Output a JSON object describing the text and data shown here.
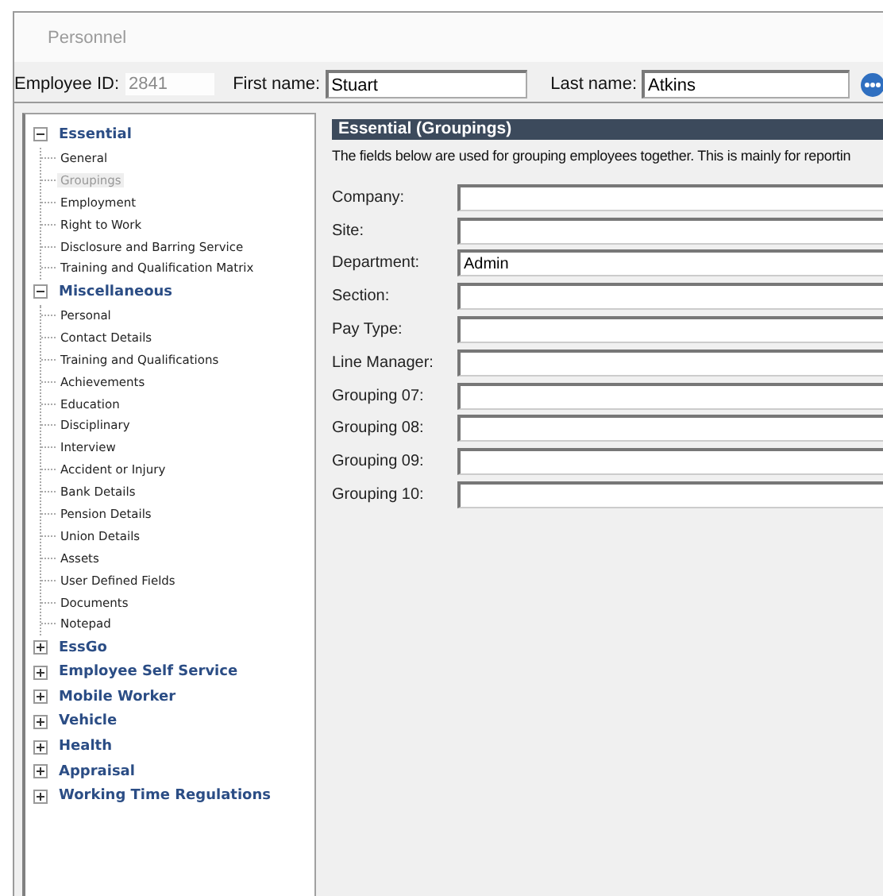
{
  "window": {
    "title": "Personnel"
  },
  "header": {
    "employee_id": {
      "label": "Employee ID:",
      "value": "2841"
    },
    "first_name": {
      "label": "First name:",
      "value": "Stuart"
    },
    "last_name": {
      "label": "Last name:",
      "value": "Atkins"
    }
  },
  "sidebar": {
    "groups": [
      {
        "label": "Essential",
        "expanded": true,
        "children": [
          {
            "label": "General",
            "selected": false
          },
          {
            "label": "Groupings",
            "selected": true
          },
          {
            "label": "Employment",
            "selected": false
          },
          {
            "label": "Right to Work",
            "selected": false
          },
          {
            "label": "Disclosure and Barring Service",
            "selected": false
          },
          {
            "label": "Training and Qualification Matrix",
            "selected": false
          }
        ]
      },
      {
        "label": "Miscellaneous",
        "expanded": true,
        "children": [
          {
            "label": "Personal",
            "selected": false
          },
          {
            "label": "Contact Details",
            "selected": false
          },
          {
            "label": "Training and Qualifications",
            "selected": false
          },
          {
            "label": "Achievements",
            "selected": false
          },
          {
            "label": "Education",
            "selected": false
          },
          {
            "label": "Disciplinary",
            "selected": false
          },
          {
            "label": "Interview",
            "selected": false
          },
          {
            "label": "Accident or Injury",
            "selected": false
          },
          {
            "label": "Bank Details",
            "selected": false
          },
          {
            "label": "Pension Details",
            "selected": false
          },
          {
            "label": "Union Details",
            "selected": false
          },
          {
            "label": "Assets",
            "selected": false
          },
          {
            "label": "User Defined Fields",
            "selected": false
          },
          {
            "label": "Documents",
            "selected": false
          },
          {
            "label": "Notepad",
            "selected": false
          }
        ]
      },
      {
        "label": "EssGo",
        "expanded": false
      },
      {
        "label": "Employee Self Service",
        "expanded": false
      },
      {
        "label": "Mobile Worker",
        "expanded": false
      },
      {
        "label": "Vehicle",
        "expanded": false
      },
      {
        "label": "Health",
        "expanded": false
      },
      {
        "label": "Appraisal",
        "expanded": false
      },
      {
        "label": "Working Time Regulations",
        "expanded": false
      }
    ]
  },
  "section": {
    "title": "Essential (Groupings)",
    "description": "The fields below are used for grouping employees together. This is mainly for reportin",
    "fields": [
      {
        "label": "Company:"
      },
      {
        "label": "Site:"
      },
      {
        "label": "Department:",
        "value": "Admin"
      },
      {
        "label": "Section:"
      },
      {
        "label": "Pay Type:"
      },
      {
        "label": "Line Manager:"
      },
      {
        "label": "Grouping 07:"
      },
      {
        "label": "Grouping 08:"
      },
      {
        "label": "Grouping 09:"
      },
      {
        "label": "Grouping 10:"
      }
    ]
  }
}
